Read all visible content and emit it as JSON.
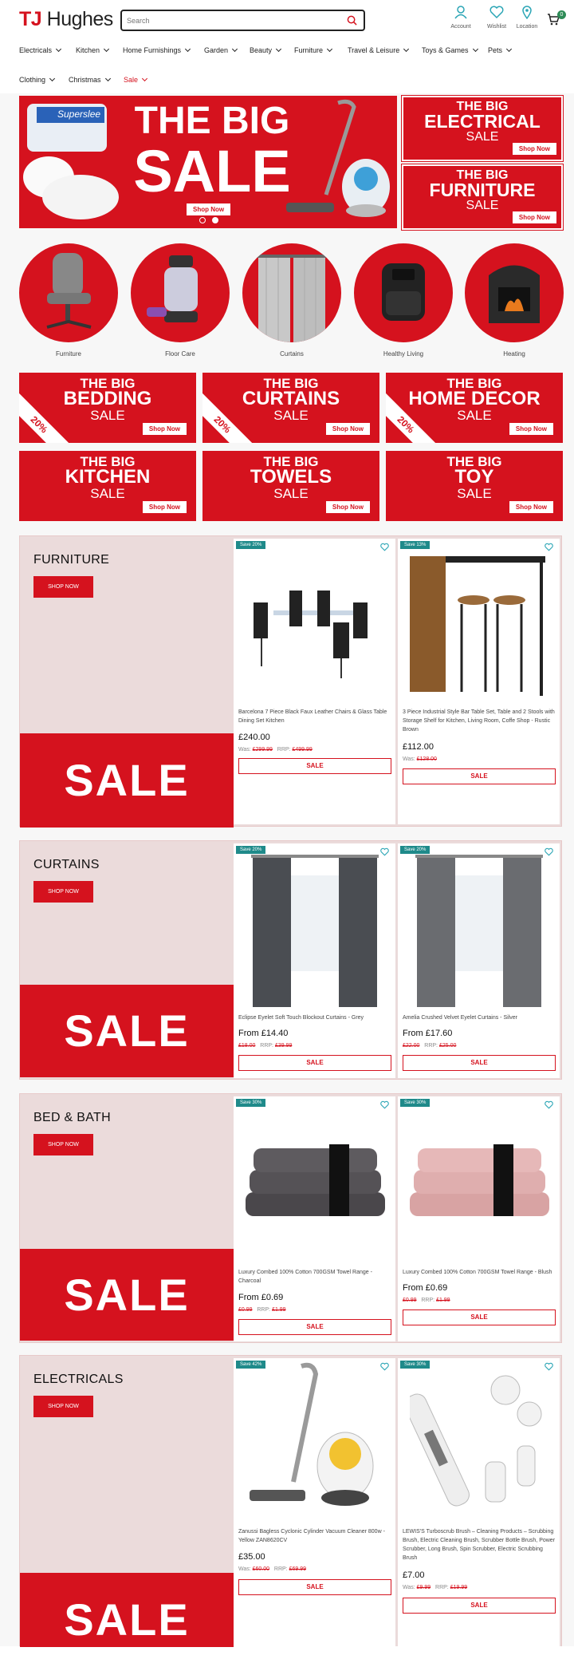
{
  "header": {
    "logo_tj": "TJ",
    "logo_rest": " Hughes",
    "search_placeholder": "Search",
    "account": "Account",
    "wishlist": "Wishlist",
    "location": "Location",
    "cart_count": "0"
  },
  "nav": [
    "Electricals",
    "Kitchen",
    "Home Furnishings",
    "Garden",
    "Beauty",
    "Furniture",
    "Travel & Leisure",
    "Toys & Games",
    "Pets",
    "Clothing",
    "Christmas",
    "Sale"
  ],
  "hero": {
    "l1": "THE BIG",
    "l2": "SALE",
    "btn": "Shop Now",
    "pillow_brand": "Superslee"
  },
  "side": [
    {
      "l1": "THE BIG",
      "l2": "ELECTRICAL",
      "l3": "SALE",
      "btn": "Shop Now"
    },
    {
      "l1": "THE BIG",
      "l2": "FURNITURE",
      "l3": "SALE",
      "btn": "Shop Now"
    }
  ],
  "circles": [
    "Furniture",
    "Floor Care",
    "Curtains",
    "Healthy Living",
    "Heating"
  ],
  "tiles": [
    {
      "l1": "THE BIG",
      "l2": "BEDDING",
      "l3": "SALE",
      "btn": "Shop Now",
      "ribbon": "20%"
    },
    {
      "l1": "THE BIG",
      "l2": "CURTAINS",
      "l3": "SALE",
      "btn": "Shop Now",
      "ribbon": "20%"
    },
    {
      "l1": "THE BIG",
      "l2": "HOME DECOR",
      "l3": "SALE",
      "btn": "Shop Now",
      "ribbon": "20%"
    },
    {
      "l1": "THE BIG",
      "l2": "KITCHEN",
      "l3": "SALE",
      "btn": "Shop Now"
    },
    {
      "l1": "THE BIG",
      "l2": "TOWELS",
      "l3": "SALE",
      "btn": "Shop Now"
    },
    {
      "l1": "THE BIG",
      "l2": "TOY",
      "l3": "SALE",
      "btn": "Shop Now"
    }
  ],
  "sections": [
    {
      "title": "FURNITURE",
      "btn": "SHOP NOW",
      "sale": "SALE",
      "products": [
        {
          "badge": "Save 20%",
          "name": "Barcelona 7 Piece Black Faux Leather Chairs & Glass Table Dining Set Kitchen",
          "price": "£240.00",
          "was": "£299.99",
          "rrp": "£499.99",
          "btn": "SALE"
        },
        {
          "badge": "Save 13%",
          "name": "3 Piece Industrial Style Bar Table Set, Table and 2 Stools with Storage Shelf for Kitchen, Living Room, Coffe Shop - Rustic Brown",
          "price": "£112.00",
          "was": "£128.00",
          "btn": "SALE"
        }
      ]
    },
    {
      "title": "CURTAINS",
      "btn": "SHOP NOW",
      "sale": "SALE",
      "products": [
        {
          "badge": "Save 20%",
          "name": "Eclipse Eyelet Soft Touch Blockout Curtains - Grey",
          "price": "From £14.40",
          "was": "£18.00",
          "rrp": "£39.99",
          "btn": "SALE"
        },
        {
          "badge": "Save 20%",
          "name": "Amelia Crushed Velvet Eyelet Curtains - Silver",
          "price": "From £17.60",
          "was": "£22.00",
          "rrp": "£25.00",
          "btn": "SALE"
        }
      ]
    },
    {
      "title": "BED & BATH",
      "btn": "SHOP NOW",
      "sale": "SALE",
      "products": [
        {
          "badge": "Save 30%",
          "name": "Luxury Combed 100% Cotton 700GSM Towel Range - Charcoal",
          "price": "From £0.69",
          "was": "£0.99",
          "rrp": "£1.99",
          "btn": "SALE"
        },
        {
          "badge": "Save 30%",
          "name": "Luxury Combed 100% Cotton 700GSM Towel Range - Blush",
          "price": "From £0.69",
          "was": "£0.99",
          "rrp": "£1.99",
          "btn": "SALE"
        }
      ]
    },
    {
      "title": "ELECTRICALS",
      "btn": "SHOP NOW",
      "sale": "SALE",
      "products": [
        {
          "badge": "Save 42%",
          "name": "Zanussi Bagless Cyclonic Cylinder Vacuum Cleaner 800w - Yellow ZAN8620CV",
          "price": "£35.00",
          "was": "£60.00",
          "rrp": "£69.99",
          "btn": "SALE"
        },
        {
          "badge": "Save 30%",
          "name": "LEWIS'S Turboscrub Brush – Cleaning Products – Scrubbing Brush, Electric Cleaning Brush, Scrubber Bottle Brush, Power Scrubber, Long Brush, Spin Scrubber, Electric Scrubbing Brush",
          "price": "£7.00",
          "was": "£9.99",
          "rrp": "£19.99",
          "btn": "SALE"
        }
      ]
    }
  ],
  "labels": {
    "was": "Was:",
    "rrp": "RRP:"
  },
  "colors": {
    "brand_red": "#d5121e",
    "badge_teal": "#1f8a8a",
    "section_bg": "#ebdbdb"
  }
}
